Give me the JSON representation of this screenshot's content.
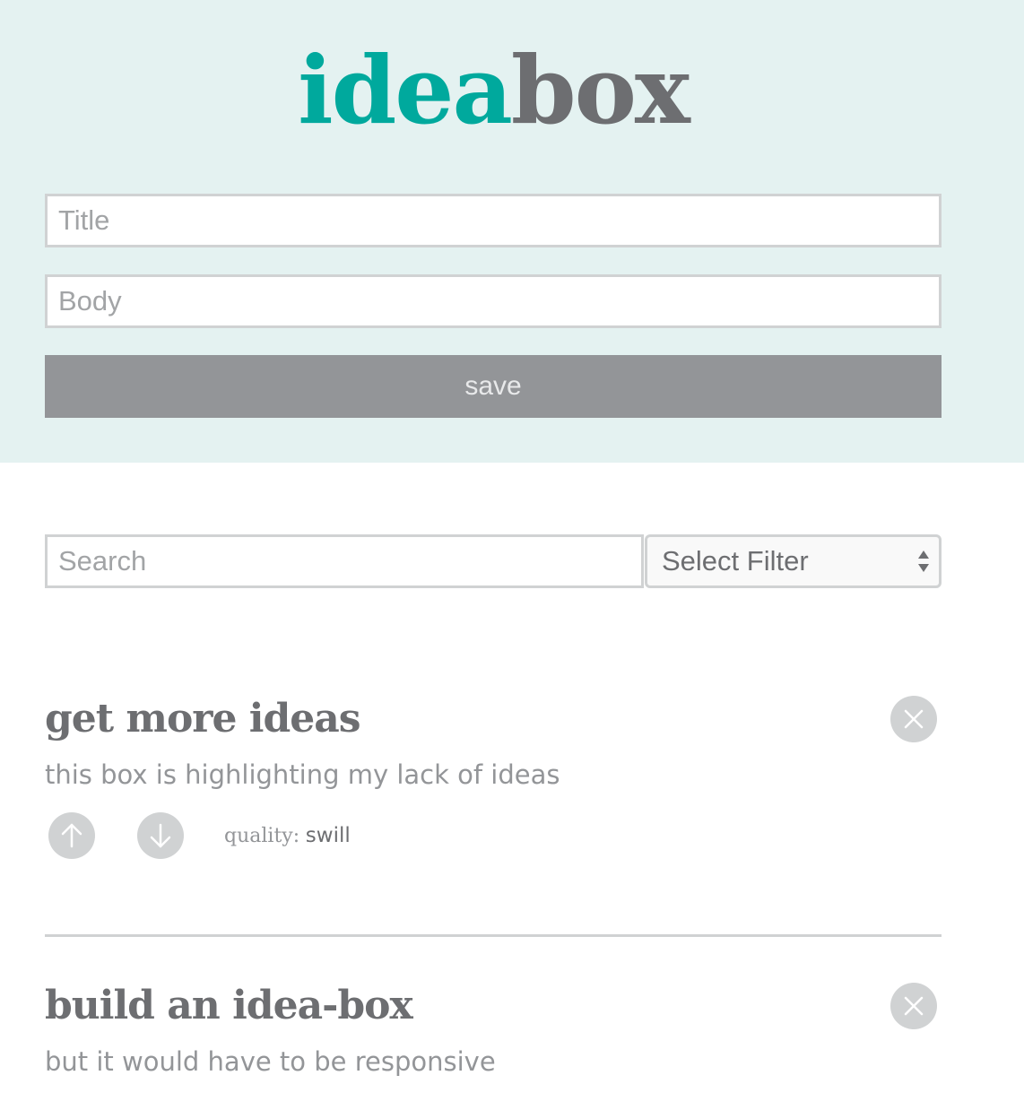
{
  "header": {
    "logo_part1": "idea",
    "logo_part2": "box",
    "title_placeholder": "Title",
    "body_placeholder": "Body",
    "save_label": "save"
  },
  "controls": {
    "search_placeholder": "Search",
    "filter_selected": "Select Filter"
  },
  "ideas": [
    {
      "title": "get more ideas",
      "body": "this box is highlighting my lack of ideas",
      "quality_label": "quality:",
      "quality_value": "swill"
    },
    {
      "title": "build an idea-box",
      "body": "but it would have to be responsive"
    }
  ],
  "icons": {
    "upvote": "arrow-up-icon",
    "downvote": "arrow-down-icon",
    "delete": "close-icon",
    "select": "select-arrows-icon"
  },
  "colors": {
    "header_bg": "#e4f2f1",
    "accent_teal": "#00a99d",
    "text_gray": "#6d6e71",
    "muted_gray": "#939598",
    "border_gray": "#d0d2d3"
  }
}
